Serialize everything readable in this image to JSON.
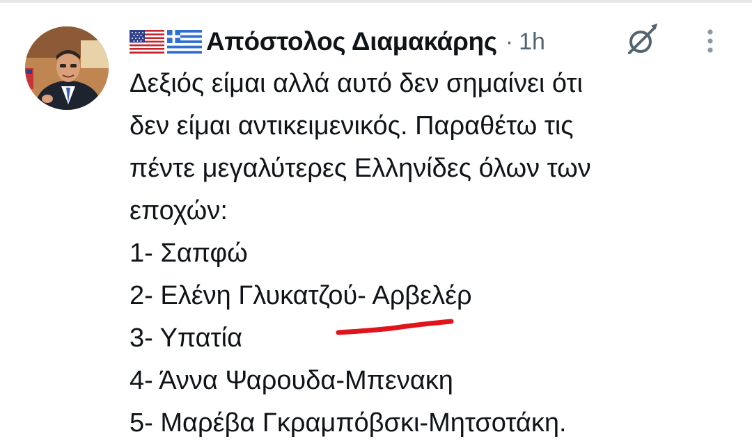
{
  "post": {
    "author": {
      "flags": [
        "us-flag",
        "greece-flag"
      ],
      "name": "Απόστολος Διαμακάρης",
      "separator": "·",
      "time": "1h"
    },
    "text_lines": [
      "Δεξιός είμαι αλλά αυτό δεν σημαίνει ότι",
      "δεν είμαι αντικειμενικός. Παραθέτω τις",
      "πέντε μεγαλύτερες Ελληνίδες όλων των",
      "εποχών:"
    ],
    "list": [
      "1- Σαπφώ",
      "2- Ελένη Γλυκατζού- Αρβελέρ",
      "3- Υπατία",
      "4- Άννα Ψαρουδα-Μπενακη",
      "5- Μαρέβα Γκραμπόβσκι-Μητσοτάκη."
    ],
    "icons": {
      "avatar": "profile-photo",
      "grok": "grok-icon",
      "more": "more-vertical-icon"
    },
    "colors": {
      "text": "#0f1419",
      "muted": "#536471",
      "annotation": "#e0151b"
    }
  }
}
